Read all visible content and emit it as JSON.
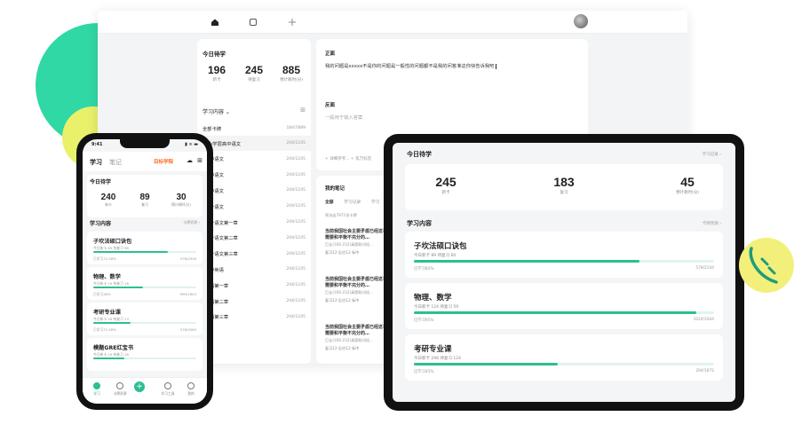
{
  "desktop": {
    "topbar": {
      "icons": [
        "home-icon",
        "square-icon",
        "plus-icon",
        "avatar"
      ]
    },
    "left": {
      "section_title": "今日待学",
      "stats": [
        {
          "value": "196",
          "label": "新卡"
        },
        {
          "value": "245",
          "label": "待复习"
        },
        {
          "value": "885",
          "label": "预计耗时(分)"
        }
      ],
      "content_title": "学习内容",
      "all_cards": {
        "name": "全部卡牌",
        "count": "184/7889"
      },
      "items": [
        {
          "name": "小学层高中语文",
          "count": "244/1245"
        },
        {
          "name": "中语文",
          "count": "244/1245"
        },
        {
          "name": "中语文",
          "count": "244/1245"
        },
        {
          "name": "中语文",
          "count": "244/1245"
        },
        {
          "name": "一语文",
          "count": "244/1245"
        },
        {
          "name": "一语文第一章",
          "count": "244/1245"
        },
        {
          "name": "一语文第二章",
          "count": "244/1245"
        },
        {
          "name": "一语文第三章",
          "count": "244/1245"
        },
        {
          "name": "中英语",
          "count": "244/1245"
        },
        {
          "name": "语第一章",
          "count": "244/1245"
        },
        {
          "name": "语第二章",
          "count": "244/1245"
        },
        {
          "name": "语第三章",
          "count": "244/1245"
        }
      ]
    },
    "editor": {
      "front_label": "正面",
      "front_text": "我的问题是xxxxx不是你的问题是一般性的问题都不是我的问答准这你快告诉我吧",
      "back_label": "反面",
      "back_placeholder": "一般用于输入答案",
      "tags": "+ 详细参考...    + 笔万标签"
    },
    "notes": {
      "title": "我的笔记",
      "tabs": [
        "全部",
        "学习记录",
        "学习"
      ],
      "hint": "筛选出7871张卡牌",
      "cards": [
        {
          "text": "当前我国社会主要矛盾已经这不需要和平衡不充分的…",
          "meta": "巨友(166-232)真题联词组…",
          "foot": "复习12  反应12  标中"
        },
        {
          "text": "当前我国社会主要矛盾已经这不需要和平衡不充分的…",
          "meta": "巨友(166-232)真题联词组…",
          "foot": "复习12  反应12  标中"
        },
        {
          "text": "当前我国社会主要矛盾已经这不需要和平衡不充分的…",
          "meta": "巨友(166-232)真题联词组…",
          "foot": "复习12  反应12  标中"
        }
      ]
    }
  },
  "phone": {
    "time": "9:41",
    "status_right": "▮ ≋ ▬",
    "tab_study": "学习",
    "tab_notes": "笔记",
    "brand": "目标学院",
    "section_today": "今日待学",
    "stats": [
      {
        "value": "240",
        "label": "新卡"
      },
      {
        "value": "89",
        "label": "复习"
      },
      {
        "value": "30",
        "label": "预计耗时(分)"
      }
    ],
    "section_content": "学习内容",
    "section_content_right": "卡牌资源 ›",
    "courses": [
      {
        "name": "子坎法硕口诀包",
        "meta": "今日新卡 89  待复习 98",
        "progress": 0.72,
        "left": "已学习72.58%",
        "right": "578/2946"
      },
      {
        "name": "物理、数学",
        "meta": "今日新卡 19  待复习 18",
        "progress": 0.48,
        "left": "已学习48%",
        "right": "960/1843"
      },
      {
        "name": "考研专业课",
        "meta": "今日新卡 18  待复习 13",
        "progress": 0.36,
        "left": "已学习71.58%",
        "right": "576/5065"
      },
      {
        "name": "模题GRE红宝书",
        "meta": "今日新卡 19  待复习 18",
        "progress": 0.3,
        "left": "",
        "right": ""
      }
    ],
    "nav": [
      "学习",
      "卡牌资源",
      "",
      "学习工具",
      "我的"
    ]
  },
  "tablet": {
    "section_today": "今日待学",
    "section_today_right": "学习记录 ›",
    "stats": [
      {
        "value": "245",
        "label": "新卡"
      },
      {
        "value": "183",
        "label": "复习"
      },
      {
        "value": "45",
        "label": "预计耗时(分)"
      }
    ],
    "section_content": "学习内容",
    "section_content_right": "卡牌资源 ›",
    "courses": [
      {
        "name": "子坎法硕口诀包",
        "meta": "今日新卡 89  待复习 60",
        "progress": 0.75,
        "left": "已学习82%",
        "right": "578/2144"
      },
      {
        "name": "物理、数学",
        "meta": "今日新卡 124  待复习 59",
        "progress": 0.94,
        "left": "已学习95%",
        "right": "1024/1044"
      },
      {
        "name": "考研专业课",
        "meta": "今日新卡 298  待复习 124",
        "progress": 0.48,
        "left": "已学习45%",
        "right": "294/1672"
      }
    ]
  },
  "colors": {
    "accent": "#2dbe93",
    "blob_green": "#2fd8a4",
    "blob_yellow": "#f2f07b",
    "brand_orange": "#ff6a2a"
  }
}
